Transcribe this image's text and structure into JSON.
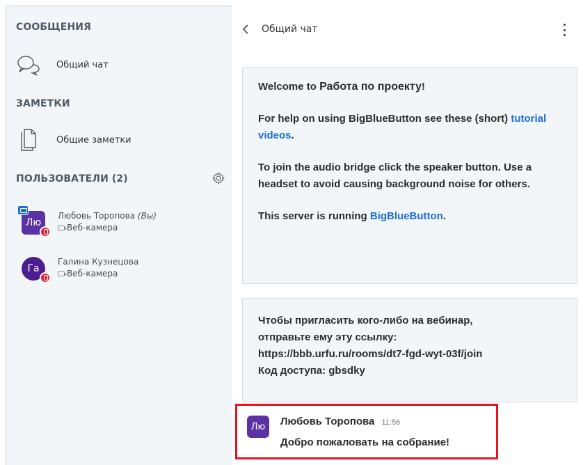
{
  "sidebar": {
    "messages_title": "СООБЩЕНИЯ",
    "public_chat": {
      "label": "Общий чат",
      "icon": "chat-bubbles-icon"
    },
    "notes_title": "ЗАМЕТКИ",
    "shared_notes": {
      "label": "Общие заметки",
      "icon": "notes-document-icon"
    },
    "users_title": "ПОЛЬЗОВАТЕЛИ (2)",
    "settings_icon": "gear-icon",
    "users": [
      {
        "initials": "Лю",
        "name": "Любовь Торопова",
        "self_marker": "(Вы)",
        "status": "Веб-камера",
        "presenter": true,
        "muted": true
      },
      {
        "initials": "Га",
        "name": "Галина Кузнецова",
        "self_marker": "",
        "status": "Веб-камера",
        "presenter": false,
        "muted": true
      }
    ]
  },
  "chat": {
    "title": "Общий чат",
    "back_icon": "chevron-left-icon",
    "menu_icon": "kebab-menu-icon",
    "welcome": {
      "welcome_prefix": "Welcome to ",
      "meeting_name": "Работа по проекту",
      "welcome_suffix": "!",
      "help_text": "For help on using BigBlueButton see these (short) ",
      "help_link": "tutorial videos",
      "help_end": ".",
      "audio_text": "To join the audio bridge click the speaker button. Use a headset to avoid causing background noise for others.",
      "server_text": "This server is running ",
      "server_link": "BigBlueButton",
      "server_end": "."
    },
    "invite": {
      "line1": "Чтобы пригласить кого-либо на вебинар,",
      "line2": "отправьте ему эту ссылку:",
      "link": "https://bbb.urfu.ru/rooms/dt7-fgd-wyt-03f/join",
      "access_label": "Код доступа: ",
      "access_code": "gbsdky"
    },
    "last_message": {
      "initials": "Лю",
      "author": "Любовь Торопова",
      "time": "11:56",
      "text": "Добро пожаловать на собрание!"
    }
  },
  "colors": {
    "sidebar_bg": "#f3f6f9",
    "avatar_purple": "#5a32a3",
    "link_blue": "#1a6fd8",
    "highlight_red": "#e8131f",
    "mute_red": "#e0243a",
    "presenter_blue": "#1f6fd6"
  }
}
